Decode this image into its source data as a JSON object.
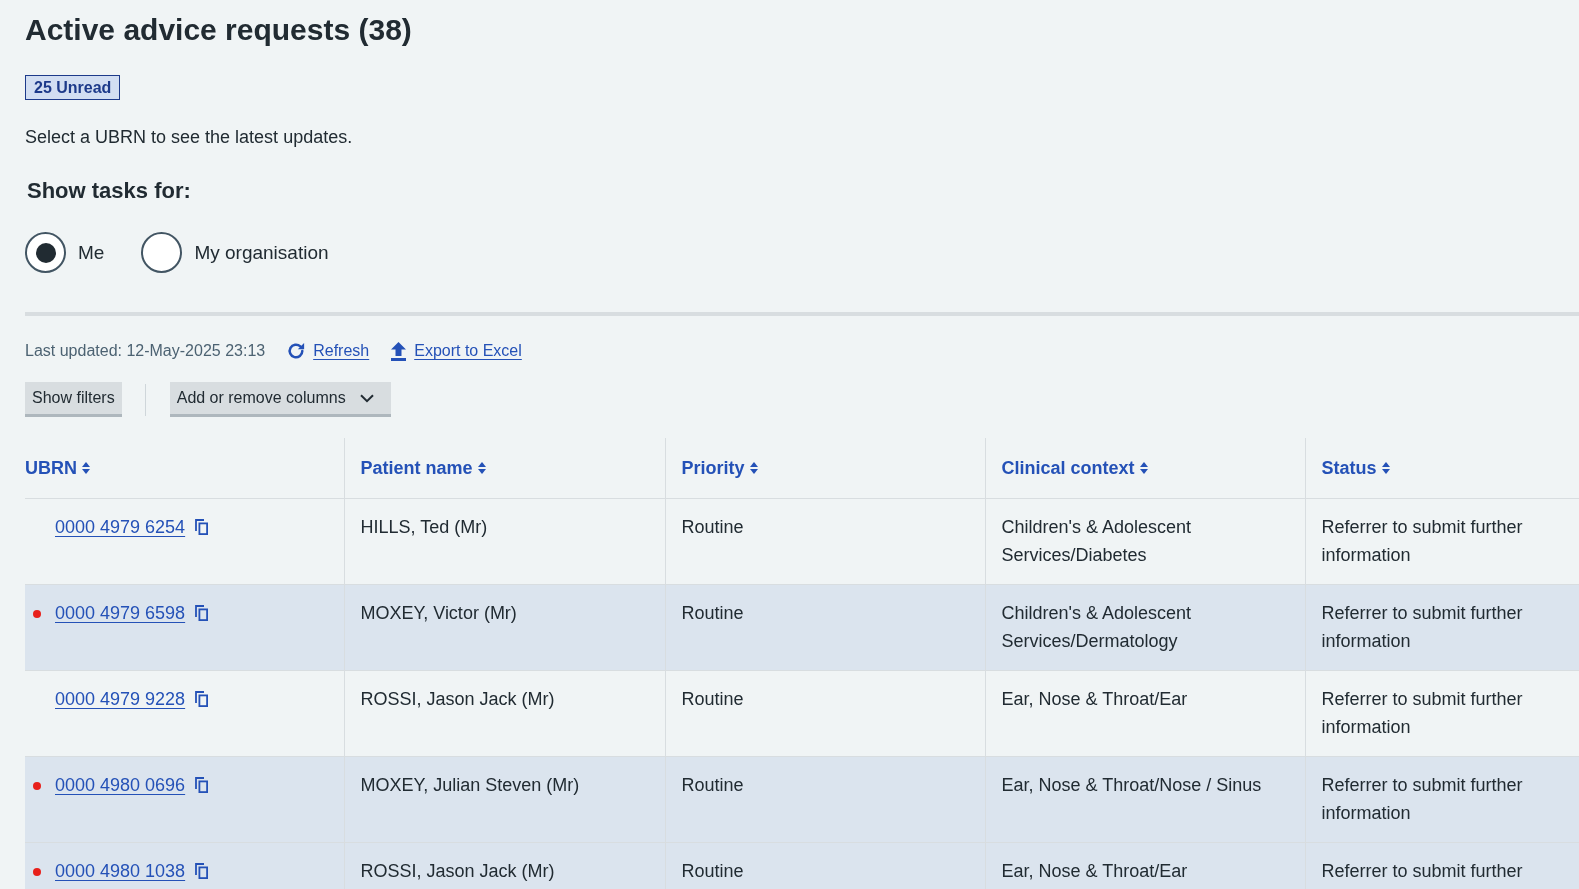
{
  "page": {
    "title": "Active advice requests (38)",
    "unread_badge": "25 Unread",
    "intro": "Select a UBRN to see the latest updates."
  },
  "task_filter": {
    "legend": "Show tasks for:",
    "options": [
      {
        "label": "Me",
        "selected": true
      },
      {
        "label": "My organisation",
        "selected": false
      }
    ]
  },
  "toolbar": {
    "last_updated": "Last updated: 12-May-2025 23:13",
    "links": [
      {
        "kind": "refresh",
        "label": "Refresh"
      },
      {
        "kind": "export",
        "label": "Export to Excel"
      }
    ],
    "buttons": [
      {
        "kind": "plain",
        "label": "Show filters"
      },
      {
        "kind": "dropdown",
        "label": "Add or remove columns"
      }
    ]
  },
  "table": {
    "columns": [
      "UBRN",
      "Patient name",
      "Priority",
      "Clinical context",
      "Status"
    ],
    "rows": [
      {
        "unread": false,
        "ubrn": "0000 4979 6254",
        "patient": "HILLS, Ted (Mr)",
        "priority": "Routine",
        "clinical_context": "Children's & Adolescent Services/Diabetes",
        "status": "Referrer to submit further information"
      },
      {
        "unread": true,
        "ubrn": "0000 4979 6598",
        "patient": "MOXEY, Victor (Mr)",
        "priority": "Routine",
        "clinical_context": "Children's & Adolescent Services/Dermatology",
        "status": "Referrer to submit further information"
      },
      {
        "unread": false,
        "ubrn": "0000 4979 9228",
        "patient": "ROSSI, Jason Jack (Mr)",
        "priority": "Routine",
        "clinical_context": "Ear, Nose & Throat/Ear",
        "status": "Referrer to submit further information"
      },
      {
        "unread": true,
        "ubrn": "0000 4980 0696",
        "patient": "MOXEY, Julian Steven (Mr)",
        "priority": "Routine",
        "clinical_context": "Ear, Nose & Throat/Nose / Sinus",
        "status": "Referrer to submit further information"
      },
      {
        "unread": true,
        "ubrn": "0000 4980 1038",
        "patient": "ROSSI, Jason Jack (Mr)",
        "priority": "Routine",
        "clinical_context": "Ear, Nose & Throat/Ear",
        "status": "Referrer to submit further"
      }
    ]
  }
}
